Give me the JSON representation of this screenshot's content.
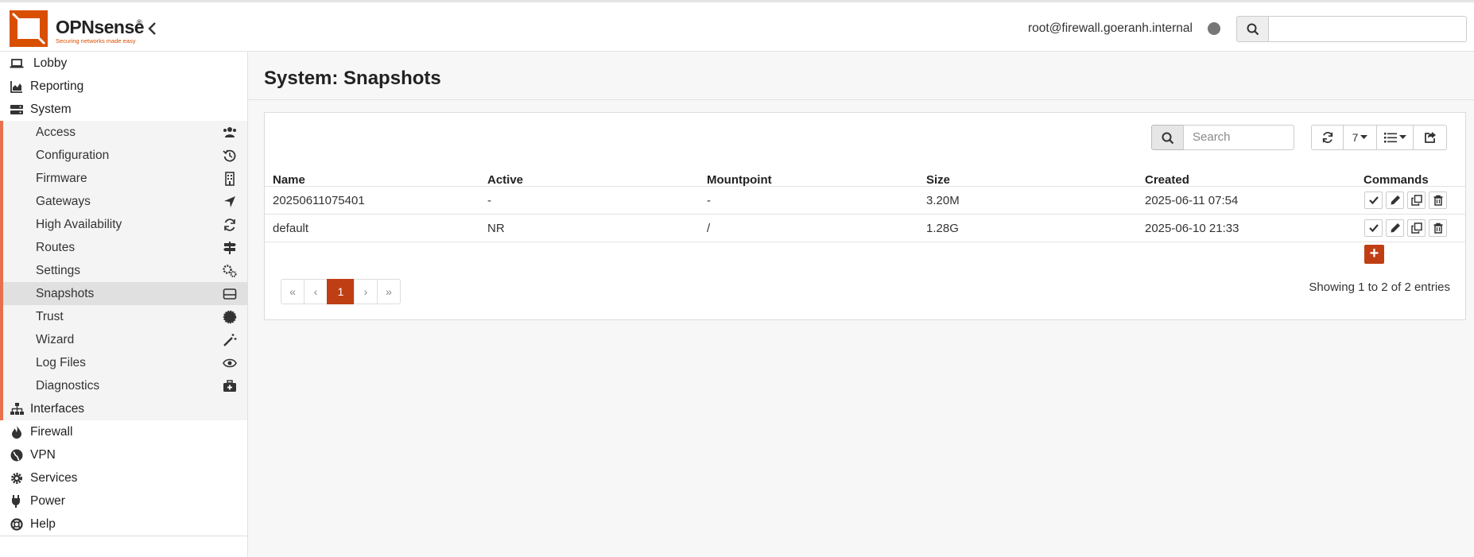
{
  "brand": {
    "name": "OPNsense",
    "registered": "®",
    "tagline": "Securing networks made easy",
    "color": "#d94f00"
  },
  "header": {
    "user": "root@firewall.goeranh.internal",
    "search_placeholder": ""
  },
  "sidebar": {
    "top_items": [
      {
        "label": "Lobby",
        "icon": "laptop-icon"
      },
      {
        "label": "Reporting",
        "icon": "area-chart-icon"
      },
      {
        "label": "System",
        "icon": "server-icon"
      }
    ],
    "system_items": [
      {
        "label": "Access",
        "icon": "users-icon"
      },
      {
        "label": "Configuration",
        "icon": "history-icon"
      },
      {
        "label": "Firmware",
        "icon": "building-icon"
      },
      {
        "label": "Gateways",
        "icon": "location-arrow-icon"
      },
      {
        "label": "High Availability",
        "icon": "refresh-icon"
      },
      {
        "label": "Routes",
        "icon": "map-signs-icon"
      },
      {
        "label": "Settings",
        "icon": "cogs-icon"
      },
      {
        "label": "Snapshots",
        "icon": "hdd-icon"
      },
      {
        "label": "Trust",
        "icon": "certificate-icon"
      },
      {
        "label": "Wizard",
        "icon": "magic-icon"
      },
      {
        "label": "Log Files",
        "icon": "eye-icon"
      },
      {
        "label": "Diagnostics",
        "icon": "medkit-icon"
      }
    ],
    "bottom_items": [
      {
        "label": "Interfaces",
        "icon": "sitemap-icon"
      },
      {
        "label": "Firewall",
        "icon": "fire-icon"
      },
      {
        "label": "VPN",
        "icon": "globe-icon"
      },
      {
        "label": "Services",
        "icon": "cog-icon"
      },
      {
        "label": "Power",
        "icon": "plug-icon"
      },
      {
        "label": "Help",
        "icon": "life-ring-icon"
      }
    ]
  },
  "page": {
    "title": "System: Snapshots"
  },
  "grid": {
    "search_placeholder": "Search",
    "row_count": "7",
    "columns": [
      "Name",
      "Active",
      "Mountpoint",
      "Size",
      "Created",
      "Commands"
    ],
    "rows": [
      {
        "name": "20250611075401",
        "active": "-",
        "mountpoint": "-",
        "size": "3.20M",
        "created": "2025-06-11 07:54"
      },
      {
        "name": "default",
        "active": "NR",
        "mountpoint": "/",
        "size": "1.28G",
        "created": "2025-06-10 21:33"
      }
    ],
    "add_label": "+",
    "pagination": {
      "first": "«",
      "prev": "‹",
      "current": "1",
      "next": "›",
      "last": "»"
    },
    "info": "Showing 1 to 2 of 2 entries"
  },
  "colors": {
    "accent": "#c03e14",
    "submenu_border": "#e8704f"
  }
}
